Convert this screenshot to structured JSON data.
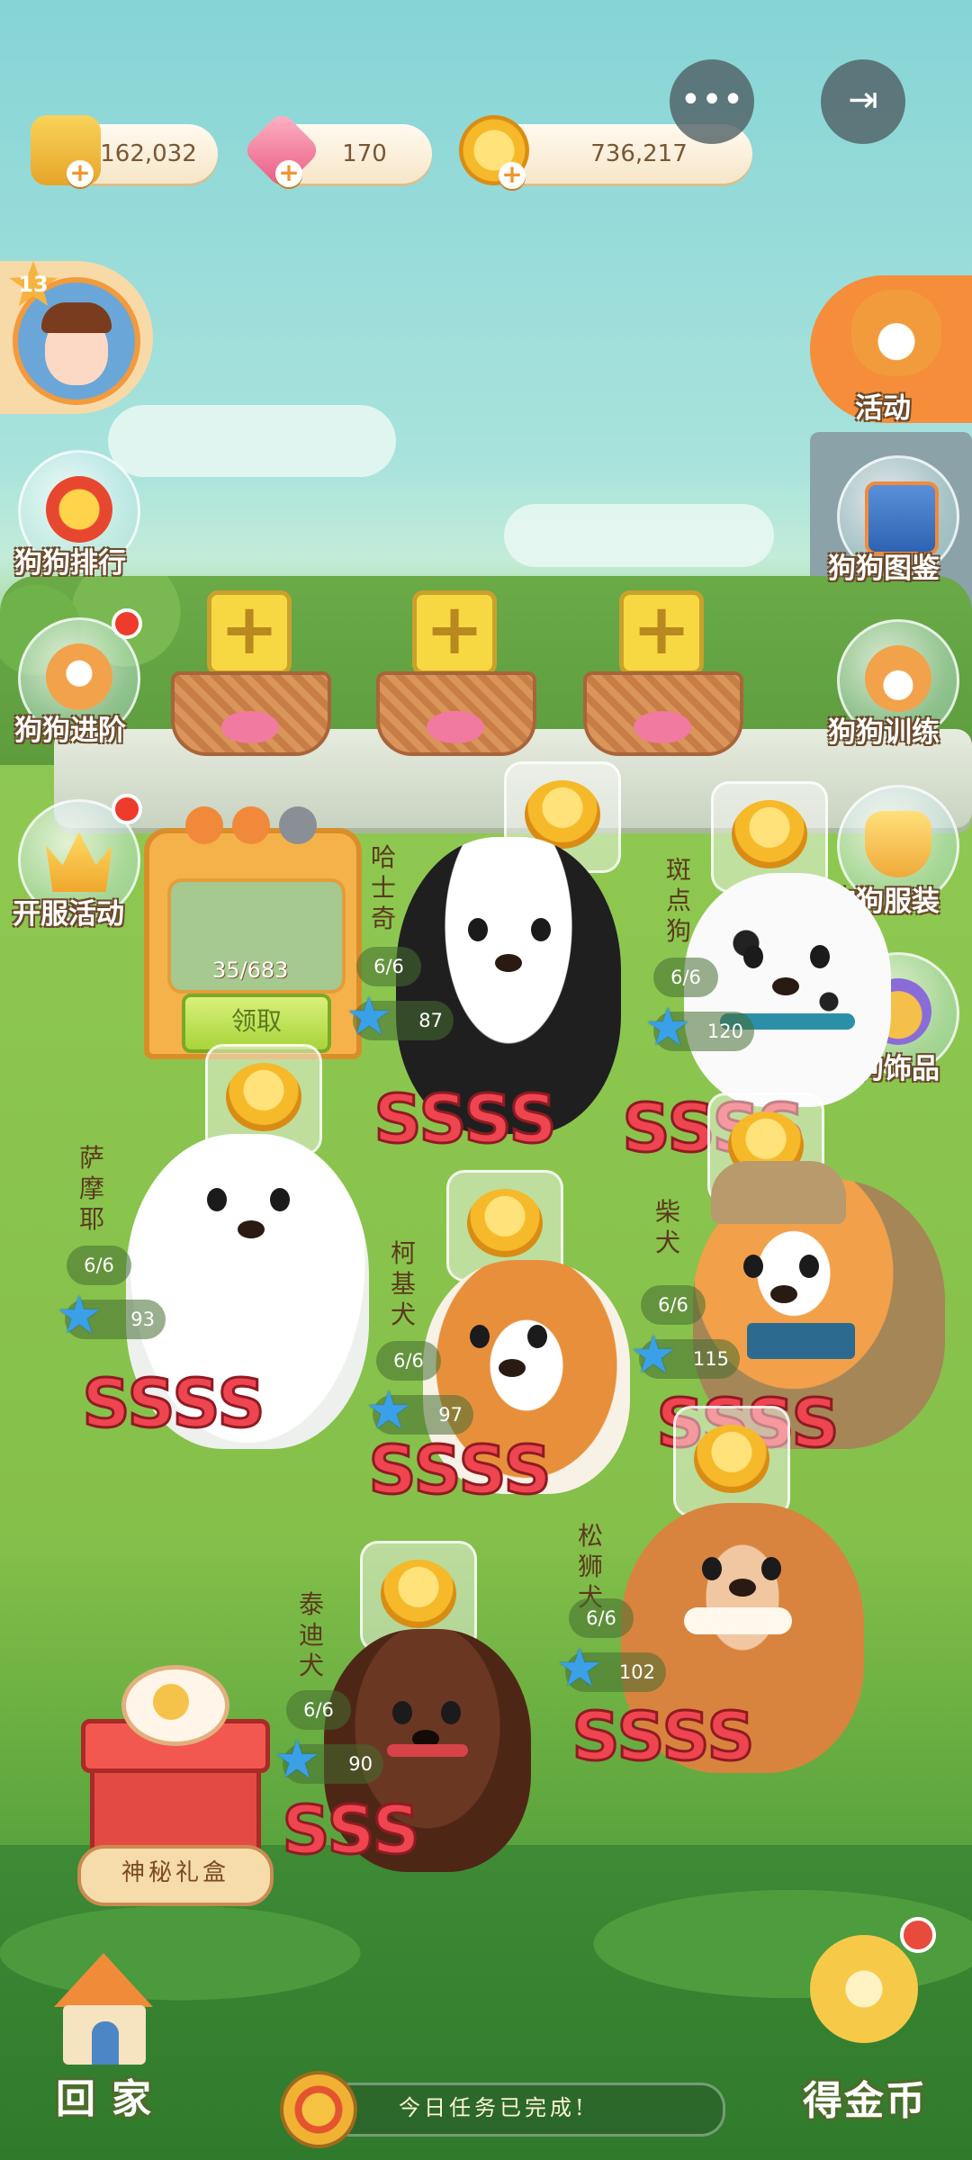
{
  "currency": {
    "food": {
      "value": "162,032",
      "icon": "dog-food-bag-icon"
    },
    "gems": {
      "value": "170",
      "icon": "pink-gem-icon"
    },
    "coins": {
      "value": "736,217",
      "icon": "gold-coin-icon"
    },
    "plus_symbol": "+"
  },
  "top_buttons": {
    "more": "•••",
    "exit": "⇥"
  },
  "player": {
    "level": "13"
  },
  "side_left": [
    {
      "label": "狗狗排行",
      "icon": "trophy-medal-icon"
    },
    {
      "label": "狗狗进阶",
      "icon": "shiba-bone-icon",
      "badge": true
    },
    {
      "label": "开服活动",
      "icon": "crown-icon",
      "badge": true
    }
  ],
  "side_right": [
    {
      "label": "活动",
      "icon": "corgi-megaphone-icon"
    },
    {
      "label": "狗狗图鉴",
      "icon": "dog-album-icon"
    },
    {
      "label": "狗狗训练",
      "icon": "shiba-training-icon"
    },
    {
      "label": "狗狗服装",
      "icon": "top-hat-icon"
    },
    {
      "label": "狗狗饰品",
      "icon": "sunglasses-icon"
    }
  ],
  "baskets": {
    "add_symbol": "+"
  },
  "cabinet": {
    "progress": "35/683",
    "claim_label": "领取"
  },
  "dogs": [
    {
      "name": "哈士奇",
      "count": "6/6",
      "level": "87",
      "grade": [
        "S",
        "S",
        "S",
        "S"
      ]
    },
    {
      "name": "斑点狗",
      "count": "6/6",
      "level": "120",
      "grade": [
        "S",
        "S",
        "S",
        "S"
      ]
    },
    {
      "name": "萨摩耶",
      "count": "6/6",
      "level": "93",
      "grade": [
        "S",
        "S",
        "S",
        "S"
      ]
    },
    {
      "name": "柯基犬",
      "count": "6/6",
      "level": "97",
      "grade": [
        "S",
        "S",
        "S",
        "S"
      ]
    },
    {
      "name": "柴犬",
      "count": "6/6",
      "level": "115",
      "grade": [
        "S",
        "S",
        "S",
        "S"
      ]
    },
    {
      "name": "松狮犬",
      "count": "6/6",
      "level": "102",
      "grade": [
        "S",
        "S",
        "S",
        "S"
      ]
    },
    {
      "name": "泰迪犬",
      "count": "6/6",
      "level": "90",
      "grade": [
        "S",
        "S",
        "S"
      ]
    }
  ],
  "bottom": {
    "gift_label": "神秘礼盒",
    "home_label": "回家",
    "coins_label": "得金币",
    "task_text": "今日任务已完成!"
  }
}
